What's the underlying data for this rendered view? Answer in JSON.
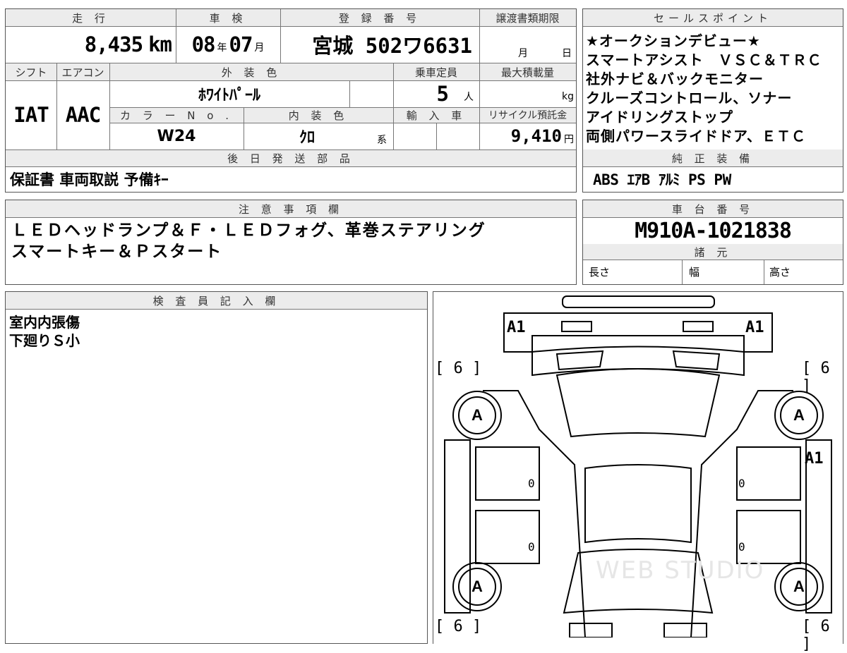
{
  "headers": {
    "mileage": "走 行",
    "shaken": "車 検",
    "registration": "登 録 番 号",
    "transfer_deadline": "譲渡書類期限",
    "shift": "シフト",
    "aircon": "エアコン",
    "exterior_color": "外 装 色",
    "capacity": "乗車定員",
    "max_load": "最大積載量",
    "color_no": "カ ラ ー N o .",
    "interior_color": "内 装 色",
    "import": "輸 入 車",
    "recycle": "リサイクル預託金",
    "later_parts": "後 日 発 送 部 品",
    "sales_points": "セールスポイント",
    "genuine_equipment": "純 正 装 備",
    "notes": "注 意 事 項 欄",
    "chassis_number": "車 台 番 号",
    "specs": "諸 元",
    "inspector": "検 査 員 記 入 欄"
  },
  "vehicle": {
    "mileage_value": "8,435",
    "mileage_unit": "km",
    "shaken_year": "08",
    "year_unit": "年",
    "shaken_month": "07",
    "month_unit": "月",
    "registration": "宮城 502ワ6631",
    "deadline_month": "月",
    "deadline_day": "日",
    "shift": "IAT",
    "aircon": "AAC",
    "exterior_color": "ﾎﾜｲﾄﾊﾟｰﾙ",
    "capacity": "5",
    "capacity_unit": "人",
    "max_load_unit": "kg",
    "color_no": "W24",
    "interior_color": "ｸﾛ",
    "interior_suffix": "系",
    "recycle_value": "9,410",
    "recycle_unit": "円",
    "later_parts": "保証書 車両取説 予備ｷｰ",
    "chassis_number": "M910A-1021838",
    "spec_length": "長さ",
    "spec_width": "幅",
    "spec_height": "高さ"
  },
  "sales_points": [
    "★オークションデビュー★",
    "スマートアシスト　ＶＳＣ＆ＴＲＣ",
    "社外ナビ＆バックモニター",
    "クルーズコントロール、ソナー",
    "アイドリングストップ",
    "両側パワースライドドア、ＥＴＣ"
  ],
  "genuine_equipment": "ABS ｴｱB ｱﾙﾐ PS PW",
  "notes": [
    "ＬＥＤヘッドランプ＆Ｆ・ＬＥＤフォグ、革巻ステアリング",
    "スマートキー＆Ｐスタート"
  ],
  "inspector_notes": [
    "室内内張傷",
    "下廻りＳ小"
  ],
  "diagram": {
    "front_left": "A1",
    "front_right": "A1",
    "bracket_tl": "[ 6 ]",
    "bracket_tr": "[ 6 ]",
    "bracket_bl": "[ 6 ]",
    "bracket_br": "[ 6 ]",
    "wheel_fl": "A",
    "wheel_fr": "A",
    "wheel_rl": "A",
    "wheel_rr": "A",
    "right_side": "A1",
    "door_fl": "0",
    "door_rl": "0",
    "door_fr": "0",
    "door_rr": "0",
    "watermark": "WEB STUDIO"
  }
}
